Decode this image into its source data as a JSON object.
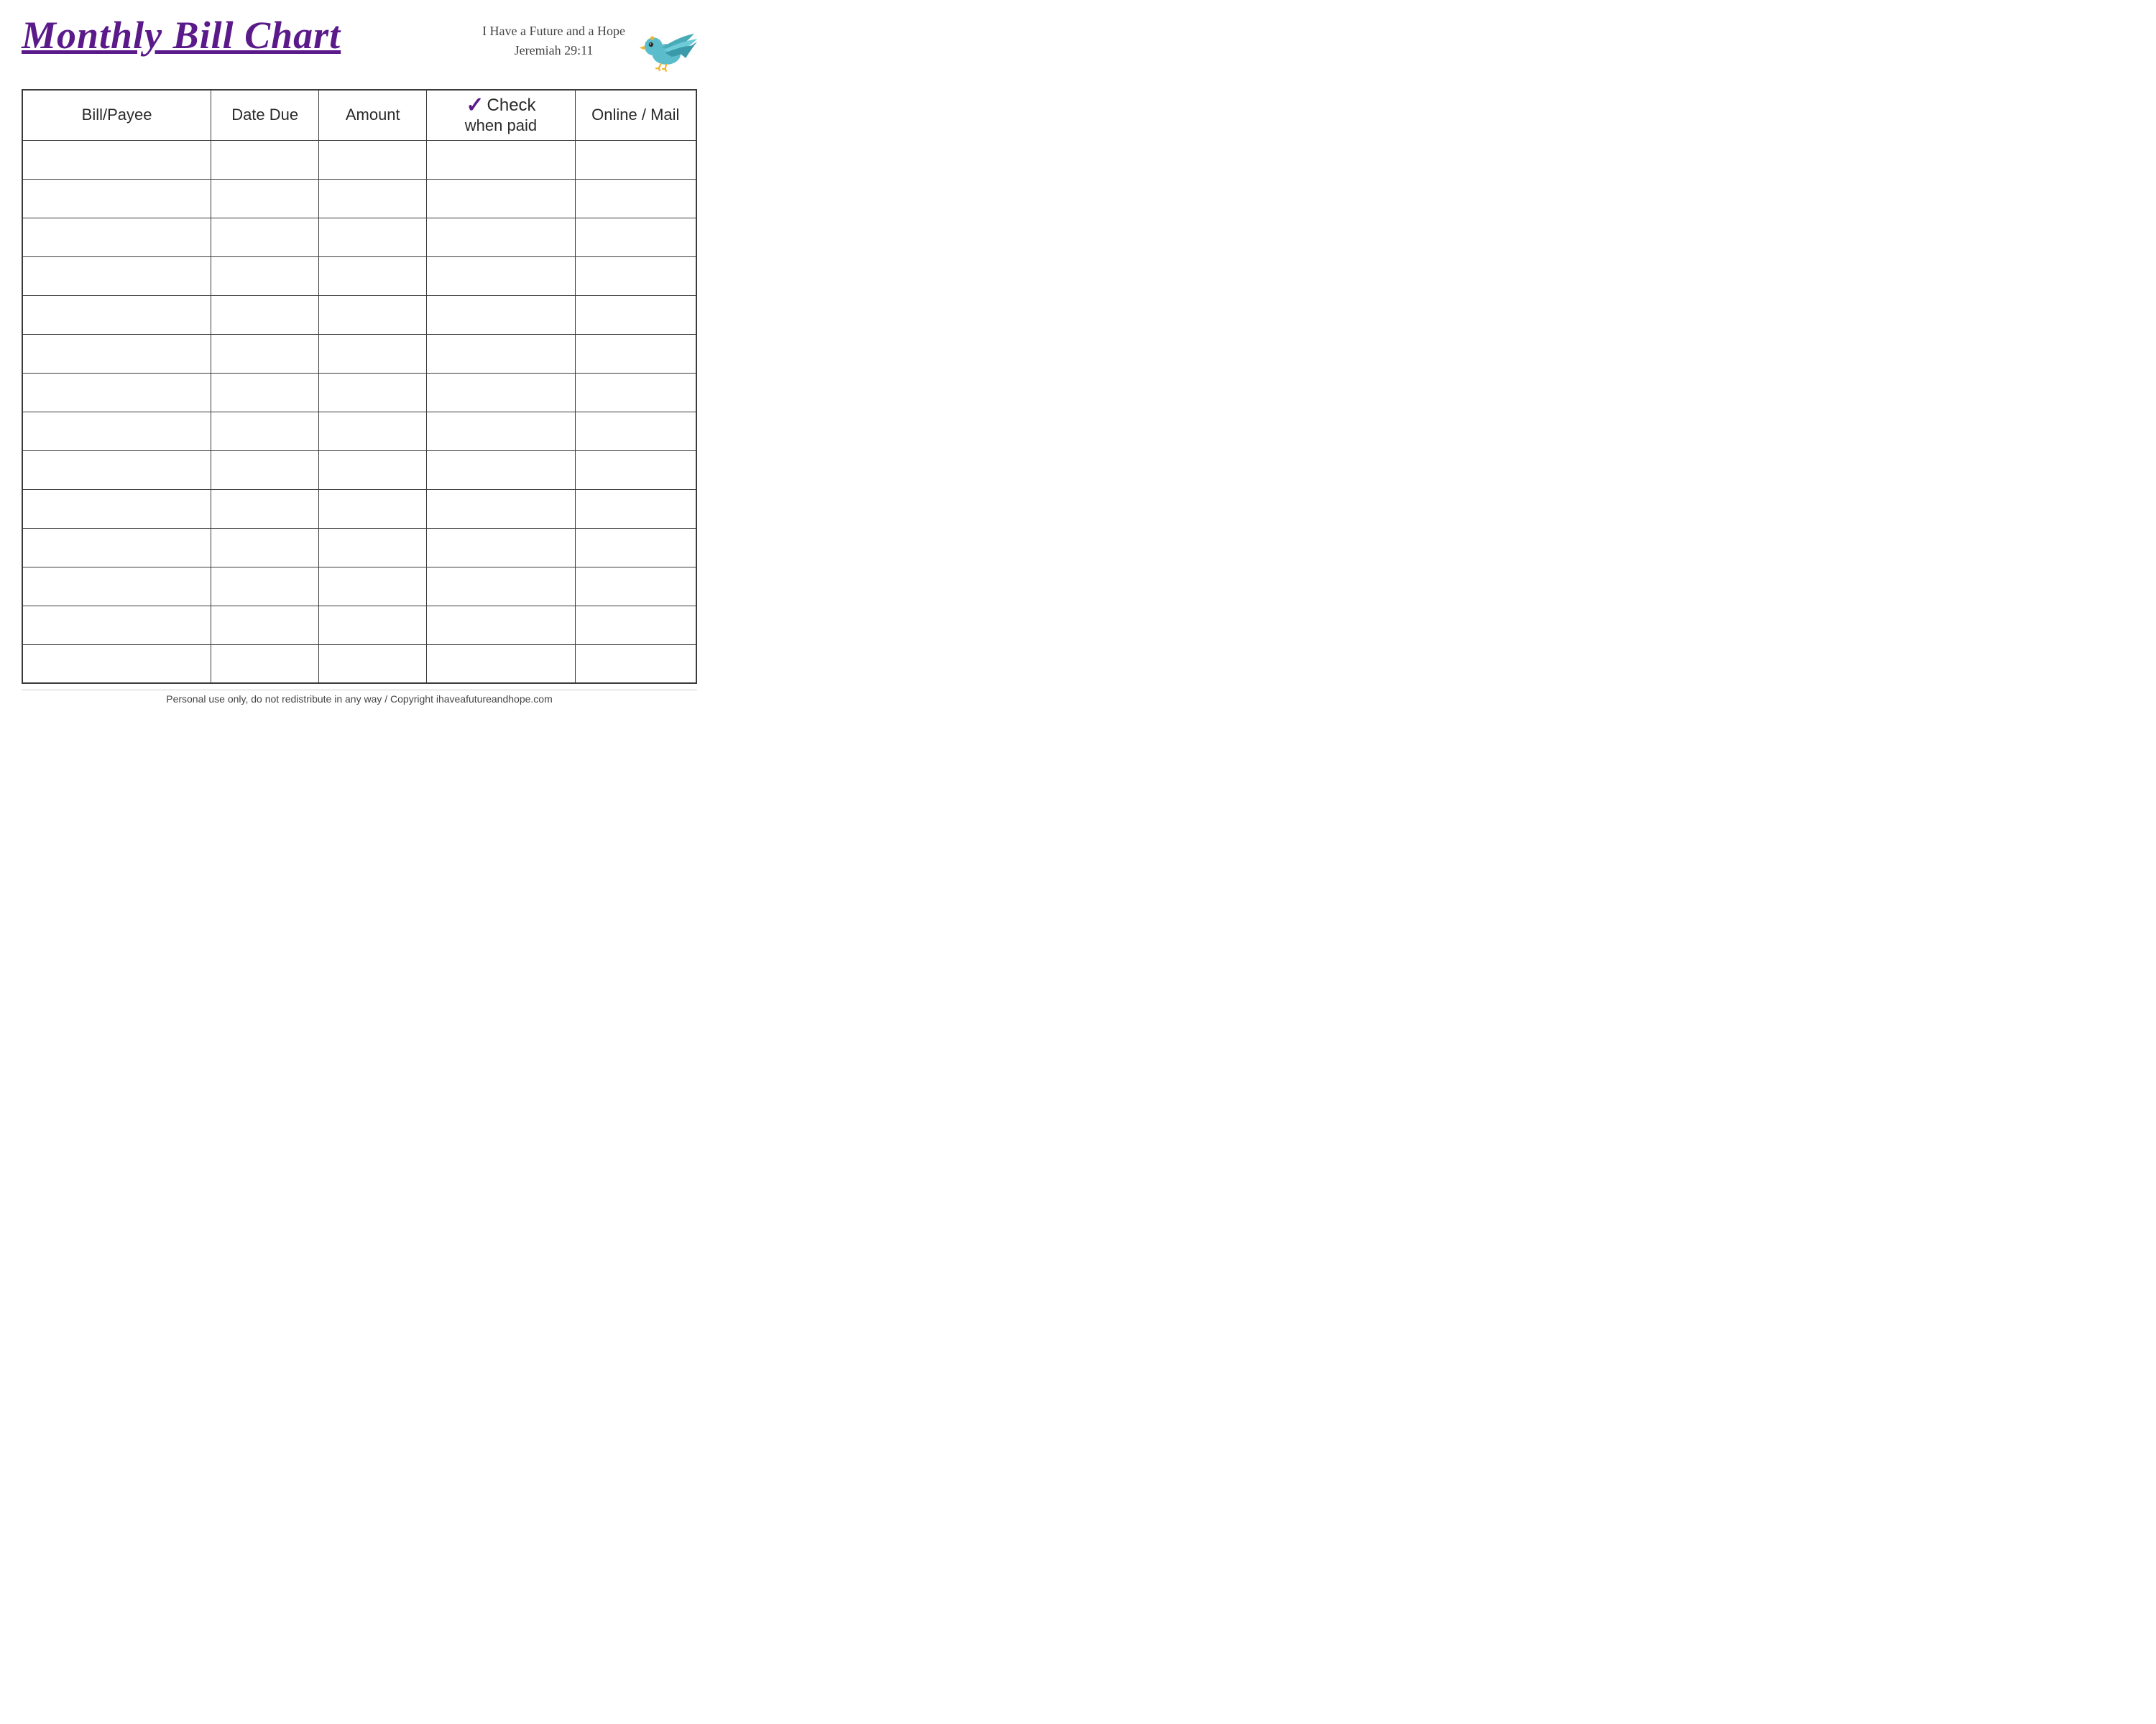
{
  "header": {
    "title": "Monthly Bill Chart",
    "scripture_line1": "I Have a Future and a Hope",
    "scripture_line2": "Jeremiah 29:11"
  },
  "table": {
    "columns": [
      {
        "id": "bill",
        "label": "Bill/Payee"
      },
      {
        "id": "date",
        "label": "Date Due"
      },
      {
        "id": "amount",
        "label": "Amount"
      },
      {
        "id": "check",
        "label": "Check",
        "sub": "when paid"
      },
      {
        "id": "online",
        "label": "Online / Mail"
      }
    ],
    "row_count": 14
  },
  "footer": {
    "text": "Personal use only, do not redistribute in any way / Copyright ihaveafutureandhope.com"
  }
}
